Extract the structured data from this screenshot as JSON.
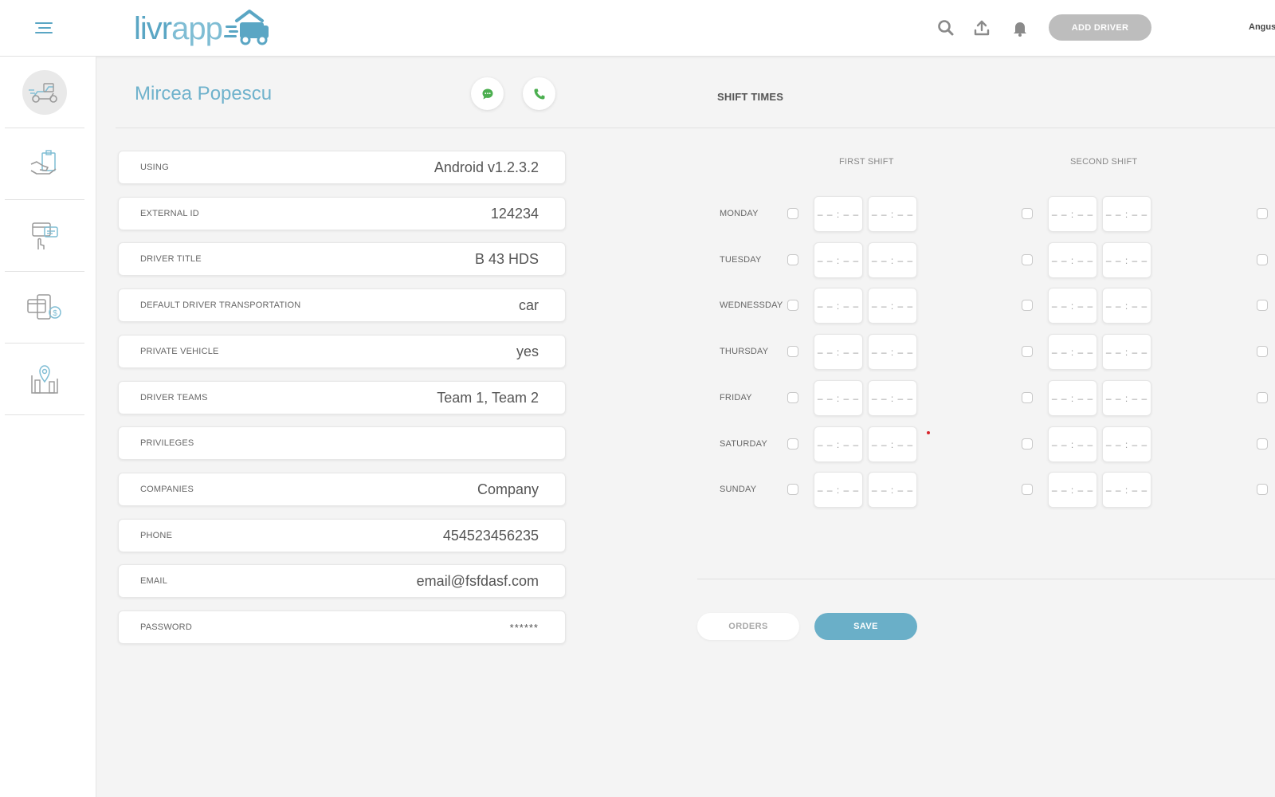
{
  "header": {
    "logo": "livrapp",
    "add_driver_label": "ADD DRIVER",
    "user_name": "Angus",
    "icons": [
      "menu-icon",
      "search-icon",
      "upload-icon",
      "bell-icon"
    ]
  },
  "sidebar": {
    "items": [
      {
        "icon": "delivery-scooter-icon",
        "active": true
      },
      {
        "icon": "hand-package-icon",
        "active": false
      },
      {
        "icon": "touch-card-icon",
        "active": false
      },
      {
        "icon": "payment-card-icon",
        "active": false
      },
      {
        "icon": "map-location-icon",
        "active": false
      }
    ]
  },
  "driver": {
    "name": "Mircea Popescu",
    "chat_icon": "chat-icon",
    "phone_icon": "phone-icon"
  },
  "fields": [
    {
      "label": "USING",
      "value": "Android v1.2.3.2"
    },
    {
      "label": "EXTERNAL ID",
      "value": "124234"
    },
    {
      "label": "DRIVER TITLE",
      "value": "B 43 HDS"
    },
    {
      "label": "DEFAULT DRIVER TRANSPORTATION",
      "value": "car"
    },
    {
      "label": "PRIVATE VEHICLE",
      "value": "yes"
    },
    {
      "label": "DRIVER TEAMS",
      "value": "Team 1, Team 2"
    },
    {
      "label": "PRIVILEGES",
      "value": ""
    },
    {
      "label": "COMPANIES",
      "value": "Company"
    },
    {
      "label": "PHONE",
      "value": "454523456235"
    },
    {
      "label": "EMAIL",
      "value": "email@fsfdasf.com"
    },
    {
      "label": "PASSWORD",
      "value": "******"
    }
  ],
  "shifts": {
    "title": "SHIFT TIMES",
    "columns": [
      "FIRST SHIFT",
      "SECOND SHIFT"
    ],
    "days": [
      "MONDAY",
      "TUESDAY",
      "WEDNESSDAY",
      "THURSDAY",
      "FRIDAY",
      "SATURDAY",
      "SUNDAY"
    ],
    "time_placeholder": "– – : – –"
  },
  "actions": {
    "orders_label": "ORDERS",
    "save_label": "SAVE"
  },
  "colors": {
    "accent": "#6aafc8",
    "brand": "#5aa6c4",
    "green": "#4caf50",
    "add_driver_bg": "#bdbdbd"
  }
}
